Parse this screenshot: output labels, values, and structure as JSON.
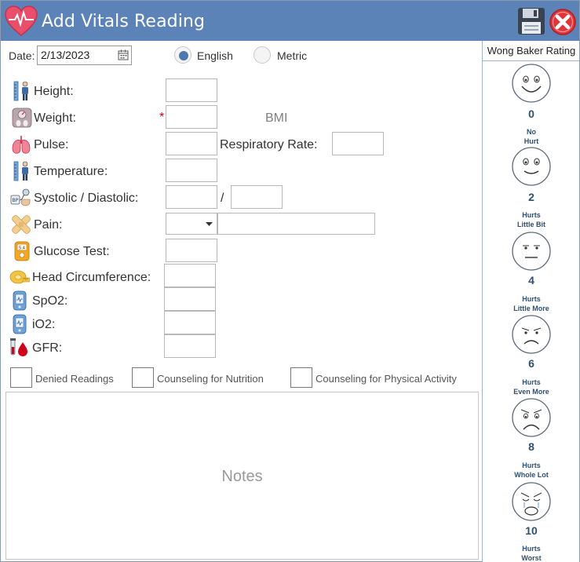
{
  "window": {
    "title": "Add Vitals Reading"
  },
  "date": {
    "label": "Date:",
    "value": "2/13/2023"
  },
  "units": {
    "english": "English",
    "metric": "Metric",
    "selected": "English"
  },
  "fields": {
    "height": "Height:",
    "weight": "Weight:",
    "required_mark": "*",
    "bmi": "BMI",
    "pulse": "Pulse:",
    "respiratory": "Respiratory Rate:",
    "temperature": "Temperature:",
    "bp": "Systolic / Diastolic:",
    "bp_sep": "/",
    "pain": "Pain:",
    "glucose": "Glucose Test:",
    "head": "Head Circumference:",
    "spo2": "SpO2:",
    "io2": "iO2:",
    "gfr": "GFR:"
  },
  "checkboxes": {
    "denied": "Denied Readings",
    "nutrition": "Counseling for Nutrition",
    "activity": "Counseling for Physical Activity"
  },
  "notes": {
    "placeholder": "Notes"
  },
  "wong_baker": {
    "title": "Wong Baker Rating",
    "faces": [
      {
        "score": "0",
        "line1": "No",
        "line2": "Hurt"
      },
      {
        "score": "2",
        "line1": "Hurts",
        "line2": "Little Bit"
      },
      {
        "score": "4",
        "line1": "Hurts",
        "line2": "Little More"
      },
      {
        "score": "6",
        "line1": "Hurts",
        "line2": "Even More"
      },
      {
        "score": "8",
        "line1": "Hurts",
        "line2": "Whole Lot"
      },
      {
        "score": "10",
        "line1": "Hurts",
        "line2": "Worst"
      }
    ]
  },
  "colors": {
    "titlebar": "#5b83b8",
    "accent": "#4f78b0",
    "close": "#e0343a",
    "required": "#d0021b"
  },
  "icons": {
    "app": "heart-icon",
    "save": "floppy-disk-icon",
    "close": "close-icon",
    "height": "person-ruler-icon",
    "weight": "scale-icon",
    "pulse": "lungs-icon",
    "temperature": "person-thermometer-icon",
    "bp": "blood-pressure-icon",
    "pain": "bandage-icon",
    "glucose": "glucose-meter-icon",
    "head": "tape-measure-icon",
    "spo2": "oximeter-icon",
    "io2": "oximeter-icon",
    "gfr": "blood-drop-icon"
  }
}
